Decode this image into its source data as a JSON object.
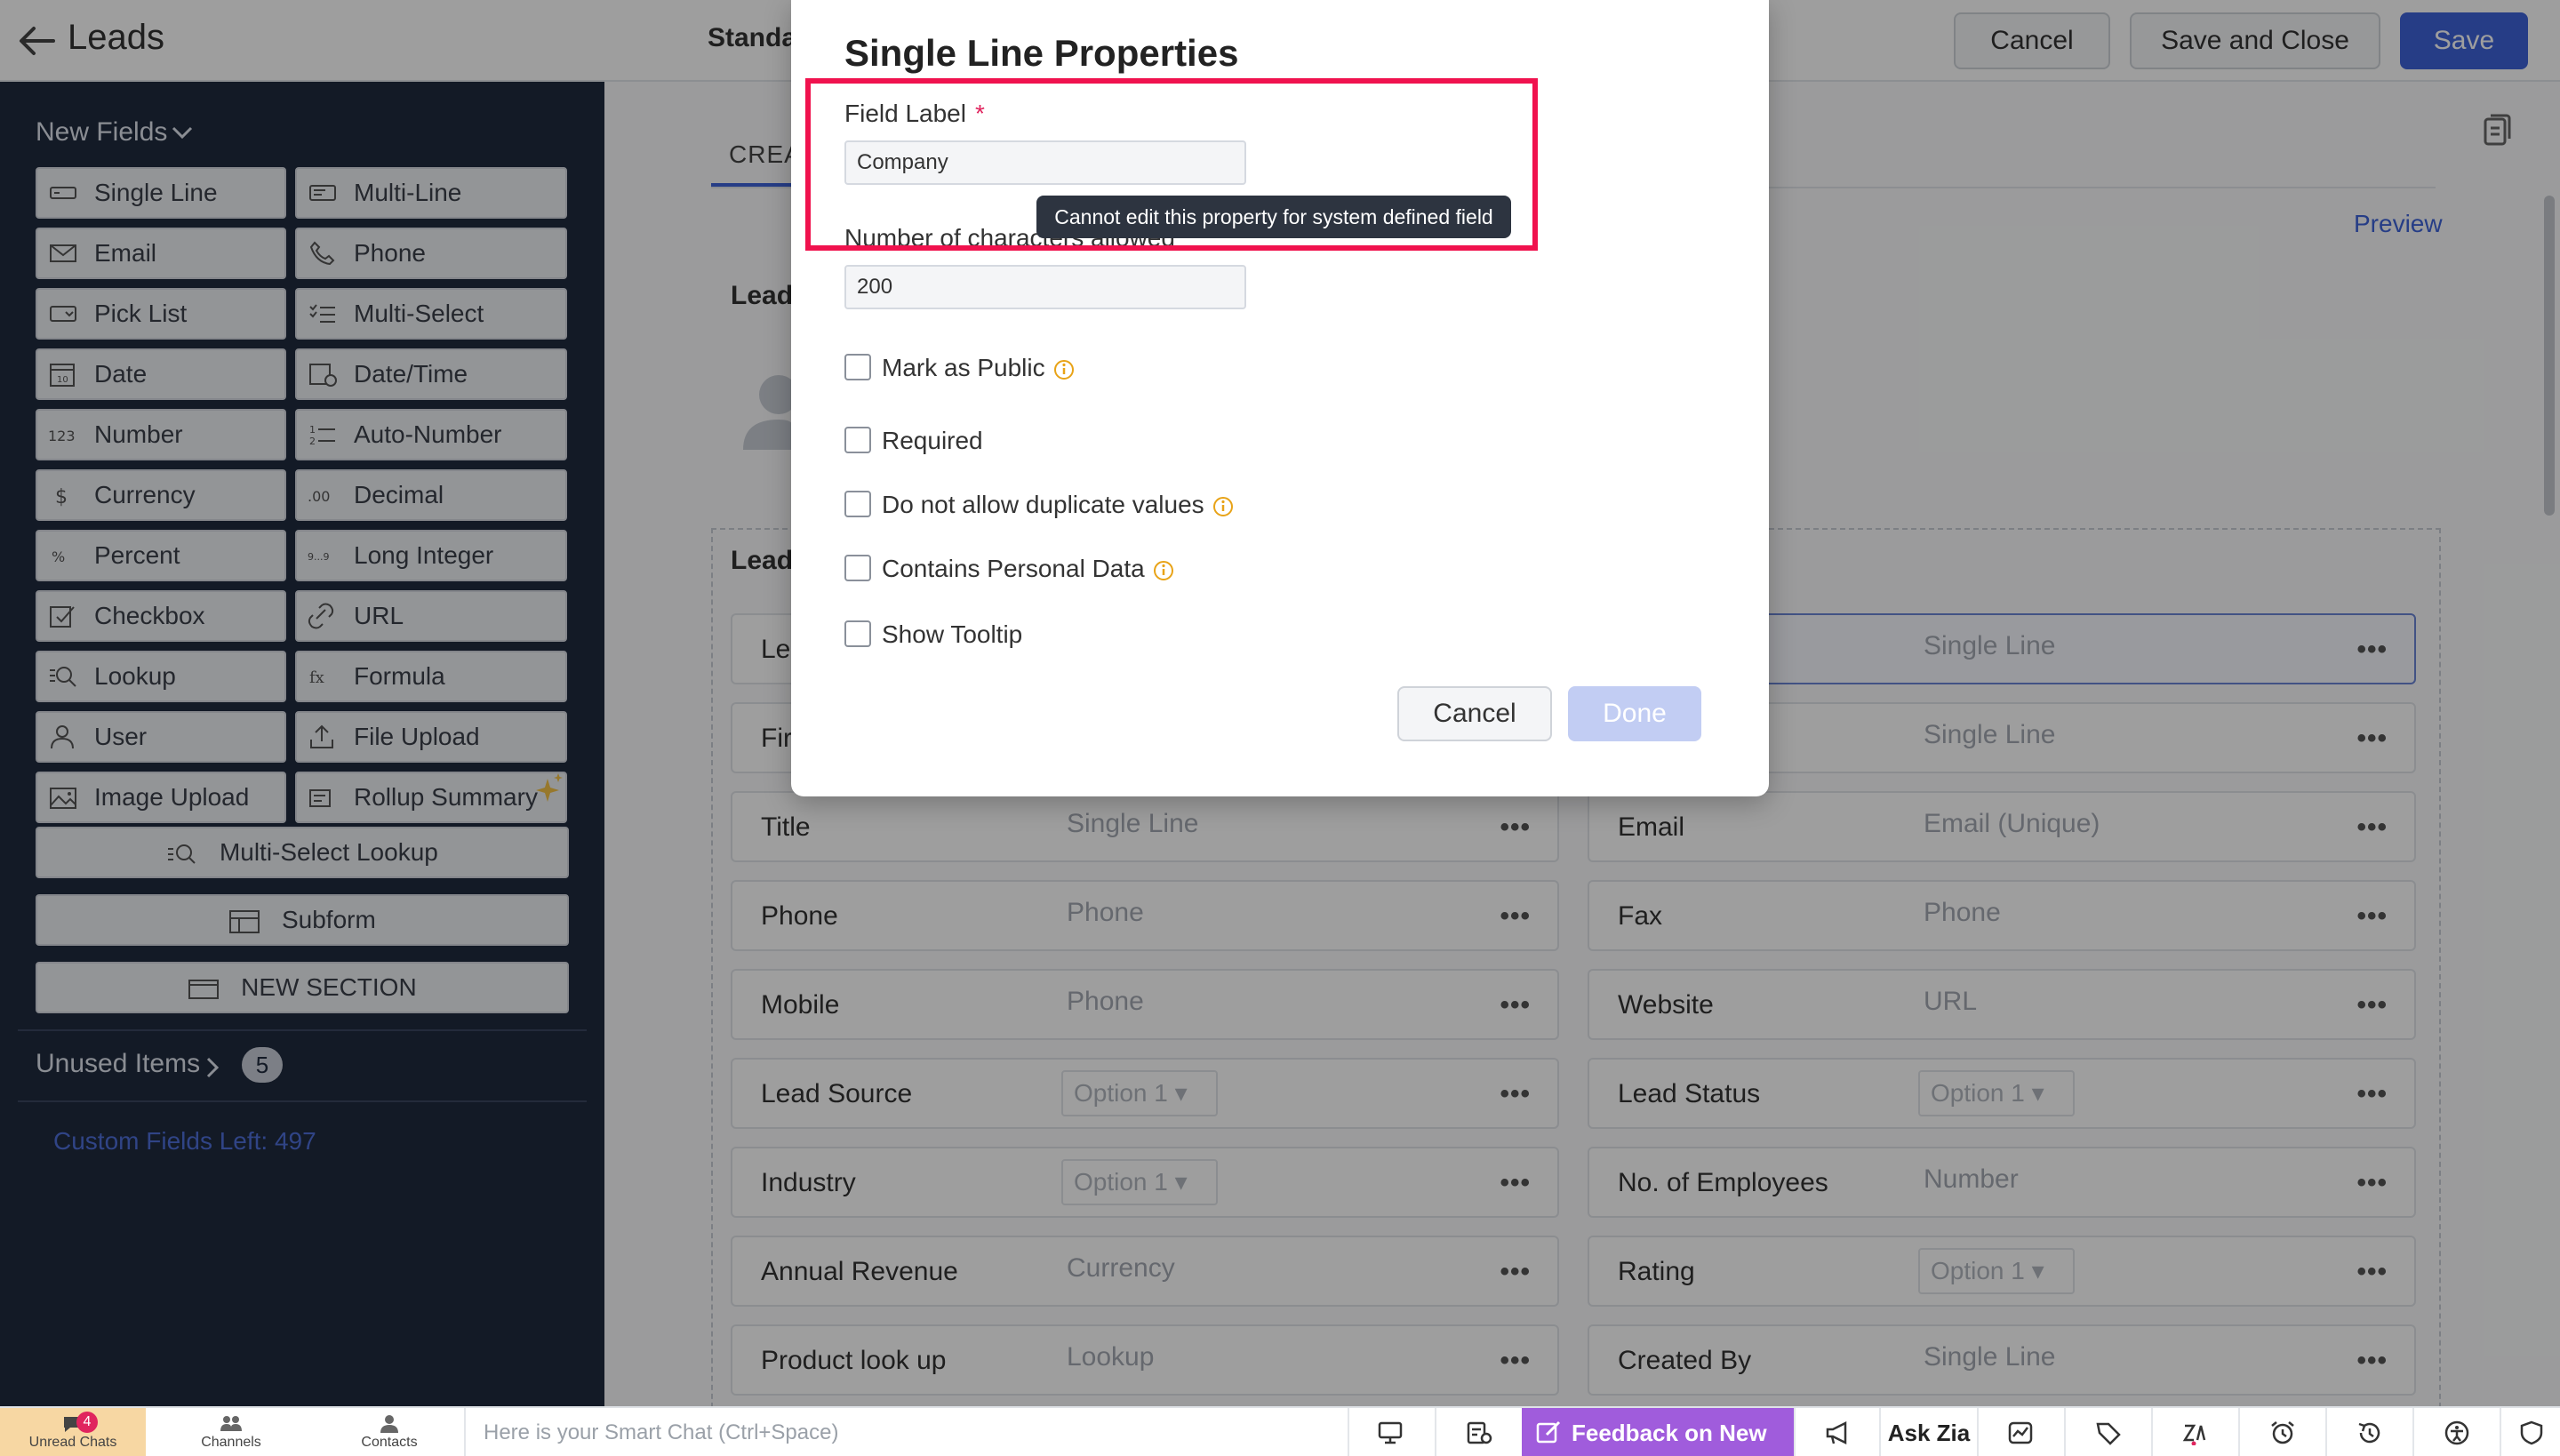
{
  "header": {
    "title": "Leads",
    "layout_name": "Standa",
    "cancel_label": "Cancel",
    "save_close_label": "Save and Close",
    "save_label": "Save"
  },
  "sidebar": {
    "new_fields_label": "New Fields",
    "fields": [
      {
        "label": "Single Line",
        "icon": "single-line-icon"
      },
      {
        "label": "Multi-Line",
        "icon": "multi-line-icon"
      },
      {
        "label": "Email",
        "icon": "email-icon"
      },
      {
        "label": "Phone",
        "icon": "phone-icon"
      },
      {
        "label": "Pick List",
        "icon": "pick-list-icon"
      },
      {
        "label": "Multi-Select",
        "icon": "multi-select-icon"
      },
      {
        "label": "Date",
        "icon": "date-icon"
      },
      {
        "label": "Date/Time",
        "icon": "date-time-icon"
      },
      {
        "label": "Number",
        "icon": "number-icon"
      },
      {
        "label": "Auto-Number",
        "icon": "auto-number-icon"
      },
      {
        "label": "Currency",
        "icon": "currency-icon"
      },
      {
        "label": "Decimal",
        "icon": "decimal-icon"
      },
      {
        "label": "Percent",
        "icon": "percent-icon"
      },
      {
        "label": "Long Integer",
        "icon": "long-integer-icon"
      },
      {
        "label": "Checkbox",
        "icon": "checkbox-icon"
      },
      {
        "label": "URL",
        "icon": "url-icon"
      },
      {
        "label": "Lookup",
        "icon": "lookup-icon"
      },
      {
        "label": "Formula",
        "icon": "formula-icon"
      },
      {
        "label": "User",
        "icon": "user-icon"
      },
      {
        "label": "File Upload",
        "icon": "file-upload-icon"
      },
      {
        "label": "Image Upload",
        "icon": "image-upload-icon"
      },
      {
        "label": "Rollup Summary",
        "icon": "rollup-summary-icon"
      }
    ],
    "multi_select_lookup_label": "Multi-Select Lookup",
    "subform_label": "Subform",
    "new_section_label": "NEW SECTION",
    "unused_items_label": "Unused Items",
    "unused_items_count": "5",
    "custom_fields_left": "Custom Fields Left: 497"
  },
  "main": {
    "tab_label": "CREA",
    "preview_label": "Preview",
    "section1_title": "Lead",
    "section2_title": "Lead",
    "rows": [
      {
        "left_label": "Le",
        "left_type": "",
        "right_label": "",
        "right_type": "Single Line"
      },
      {
        "left_label": "Fir",
        "left_type": "",
        "right_label": "",
        "right_type": "Single Line"
      },
      {
        "left_label": "Title",
        "left_type": "Single Line",
        "right_label": "Email",
        "right_type": "Email (Unique)"
      },
      {
        "left_label": "Phone",
        "left_type": "Phone",
        "right_label": "Fax",
        "right_type": "Phone"
      },
      {
        "left_label": "Mobile",
        "left_type": "Phone",
        "right_label": "Website",
        "right_type": "URL"
      },
      {
        "left_label": "Lead Source",
        "left_type": "Option 1",
        "right_label": "Lead Status",
        "right_type": "Option 1"
      },
      {
        "left_label": "Industry",
        "left_type": "Option 1",
        "right_label": "No. of Employees",
        "right_type": "Number"
      },
      {
        "left_label": "Annual Revenue",
        "left_type": "Currency",
        "right_label": "Rating",
        "right_type": "Option 1"
      },
      {
        "left_label": "Product look up",
        "left_type": "Lookup",
        "right_label": "Created By",
        "right_type": "Single Line"
      }
    ],
    "more_dots": "•••"
  },
  "modal": {
    "title": "Single Line Properties",
    "field_label_label": "Field Label",
    "required_star": "*",
    "field_label_value": "Company",
    "chars_label": "Number of characters allowed",
    "chars_value": "200",
    "tooltip": "Cannot edit this property for system defined field",
    "checkboxes": [
      {
        "label": "Mark as Public",
        "info": true
      },
      {
        "label": "Required",
        "info": false
      },
      {
        "label": "Do not allow duplicate values",
        "info": true
      },
      {
        "label": "Contains Personal Data",
        "info": true
      },
      {
        "label": "Show Tooltip",
        "info": false
      }
    ],
    "cancel_label": "Cancel",
    "done_label": "Done"
  },
  "bottombar": {
    "unread_chats_label": "Unread Chats",
    "unread_count": "4",
    "channels_label": "Channels",
    "contacts_label": "Contacts",
    "smart_chat_placeholder": "Here is your Smart Chat (Ctrl+Space)",
    "feedback_label": "Feedback on New UI",
    "ask_zia_label": "Ask Zia"
  },
  "colors": {
    "primary": "#3e63d9",
    "sidebar_bg": "#1f2a3e",
    "highlight": "#f0124e",
    "feedback_bg": "#a05cdc"
  }
}
